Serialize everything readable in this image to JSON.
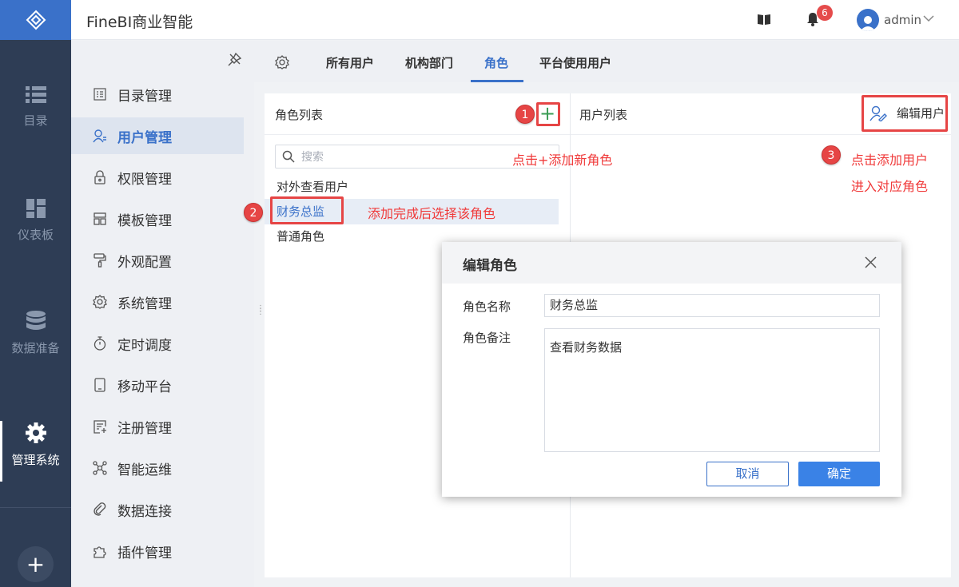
{
  "app": {
    "title": "FineBI商业智能"
  },
  "header": {
    "notification_count": "6",
    "user_name": "admin"
  },
  "rail": {
    "items": [
      {
        "label": "目录",
        "icon": "list-icon"
      },
      {
        "label": "仪表板",
        "icon": "dashboard-icon"
      },
      {
        "label": "数据准备",
        "icon": "database-icon"
      },
      {
        "label": "管理系统",
        "icon": "gear-icon",
        "active": true
      }
    ],
    "add_label": "+"
  },
  "menu": {
    "items": [
      {
        "label": "目录管理",
        "icon": "directory-icon"
      },
      {
        "label": "用户管理",
        "icon": "user-icon",
        "active": true
      },
      {
        "label": "权限管理",
        "icon": "lock-icon"
      },
      {
        "label": "模板管理",
        "icon": "template-icon"
      },
      {
        "label": "外观配置",
        "icon": "brush-icon"
      },
      {
        "label": "系统管理",
        "icon": "settings-icon"
      },
      {
        "label": "定时调度",
        "icon": "timer-icon"
      },
      {
        "label": "移动平台",
        "icon": "mobile-icon"
      },
      {
        "label": "注册管理",
        "icon": "register-icon"
      },
      {
        "label": "智能运维",
        "icon": "network-icon"
      },
      {
        "label": "数据连接",
        "icon": "link-icon"
      },
      {
        "label": "插件管理",
        "icon": "plugin-icon"
      }
    ]
  },
  "tabs": {
    "items": [
      {
        "label": "所有用户"
      },
      {
        "label": "机构部门"
      },
      {
        "label": "角色",
        "active": true
      },
      {
        "label": "平台使用用户"
      }
    ]
  },
  "role_panel": {
    "title": "角色列表",
    "add_button": "+",
    "search_placeholder": "搜索",
    "roles": [
      {
        "name": "对外查看用户"
      },
      {
        "name": "财务总监",
        "selected": true
      },
      {
        "name": "普通角色"
      }
    ]
  },
  "user_panel": {
    "title": "用户列表",
    "edit_users_label": "编辑用户"
  },
  "annotations": {
    "step1_number": "1",
    "step1_note": "点击+添加新角色",
    "step2_number": "2",
    "step2_note": "添加完成后选择该角色",
    "step3_number": "3",
    "step3_note_line1": "点击添加用户",
    "step3_note_line2": "进入对应角色"
  },
  "modal": {
    "title": "编辑角色",
    "name_label": "角色名称",
    "name_value": "财务总监",
    "remark_label": "角色备注",
    "remark_value": "查看财务数据",
    "cancel_label": "取消",
    "confirm_label": "确定"
  },
  "colors": {
    "rail_bg": "#2e3d55",
    "brand_blue": "#3a71c9",
    "annotation_red": "#e64545",
    "add_green": "#3a9c54"
  }
}
